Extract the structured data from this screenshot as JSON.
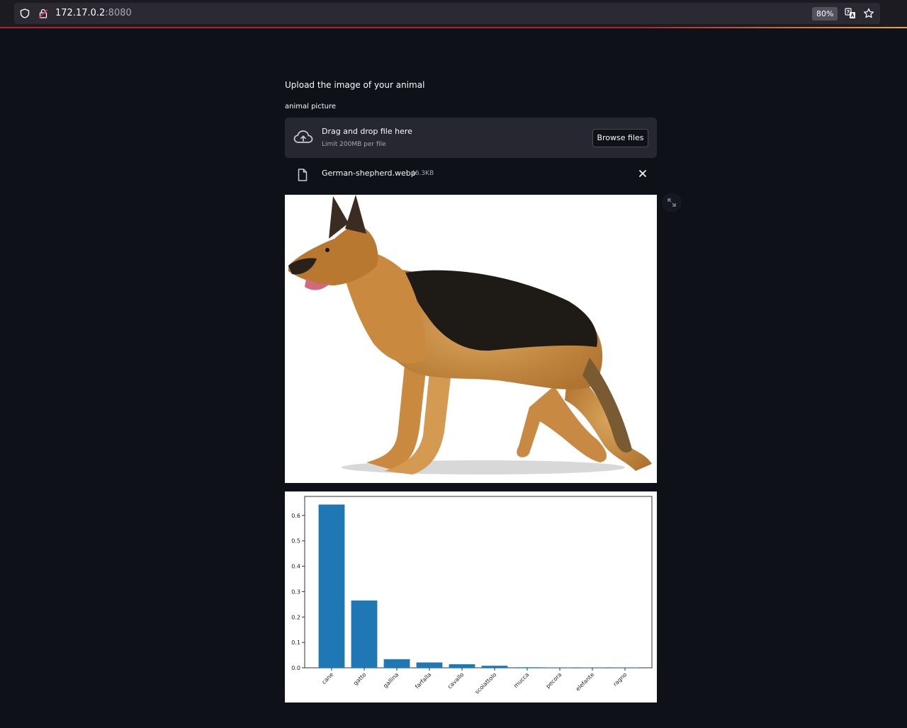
{
  "browser": {
    "url_host": "172.17.0.2",
    "url_port": ":8080",
    "zoom": "80%"
  },
  "page": {
    "heading": "Upload the image of your animal",
    "uploader_label": "animal picture",
    "dropzone_title": "Drag and drop file here",
    "dropzone_limit": "Limit 200MB per file",
    "browse_label": "Browse files",
    "file_name": "German-shepherd.webp",
    "file_size": "46.3KB"
  },
  "icons": {
    "shield": "shield-icon",
    "lock": "lock-icon",
    "translate": "translate-icon",
    "star": "star-icon",
    "cloud": "cloud-upload-icon",
    "file": "file-icon",
    "close": "close-icon",
    "fullscreen": "fullscreen-icon"
  },
  "colors": {
    "background": "#0e1117",
    "dropzone": "#262730",
    "bar": "#1f77b4"
  },
  "chart_data": {
    "type": "bar",
    "categories": [
      "cane",
      "gatto",
      "gallina",
      "farfalla",
      "cavallo",
      "scoiattolo",
      "mucca",
      "pecora",
      "elefante",
      "ragno"
    ],
    "values": [
      0.643,
      0.265,
      0.034,
      0.021,
      0.014,
      0.008,
      0.002,
      0.001,
      0.001,
      0.001
    ],
    "yticks": [
      "0.0",
      "0.1",
      "0.2",
      "0.3",
      "0.4",
      "0.5",
      "0.6"
    ],
    "ylim": [
      0,
      0.675
    ],
    "title": "",
    "xlabel": "",
    "ylabel": ""
  }
}
